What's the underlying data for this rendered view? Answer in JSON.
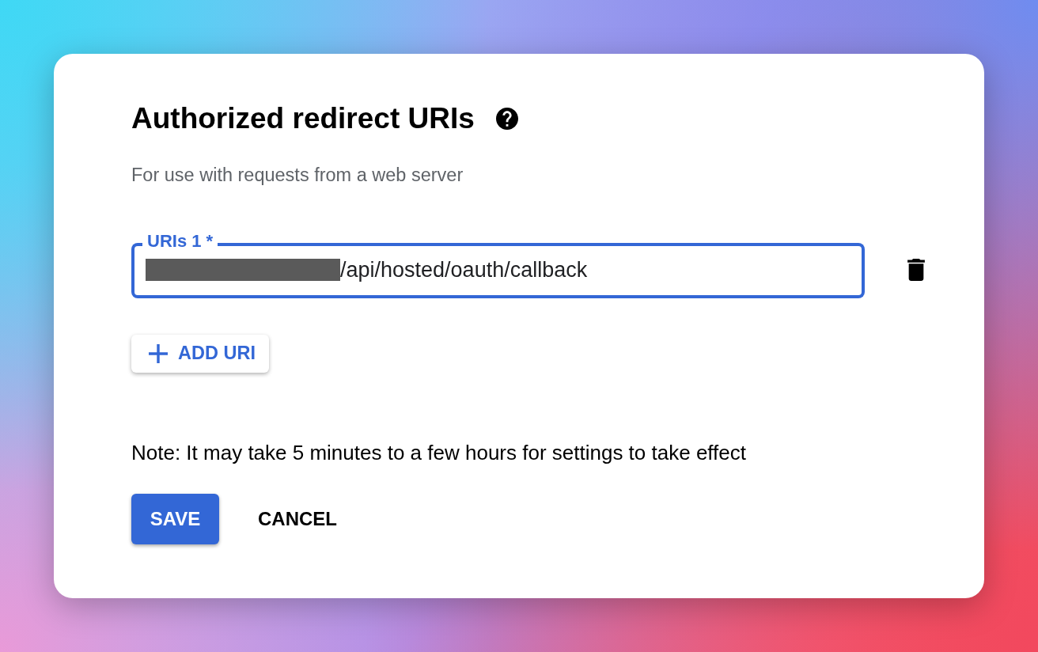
{
  "dialog": {
    "title": "Authorized redirect URIs",
    "subtitle": "For use with requests from a web server"
  },
  "uris": [
    {
      "label": "URIs 1 *",
      "value": "/api/hosted/oauth/callback",
      "redacted": true,
      "focused": true
    }
  ],
  "add_button": {
    "label": "ADD URI"
  },
  "note": "Note: It may take 5 minutes to a few hours for settings to take effect",
  "actions": [
    {
      "label": "SAVE",
      "kind": "primary"
    },
    {
      "label": "CANCEL",
      "kind": "text"
    }
  ]
}
